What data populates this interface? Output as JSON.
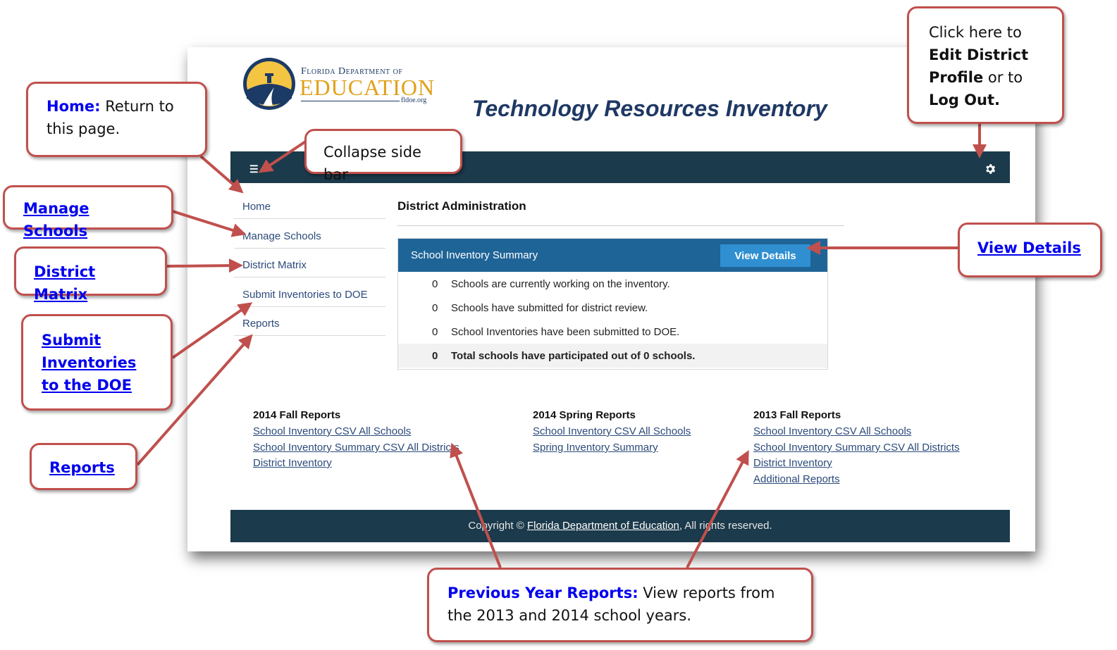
{
  "logo": {
    "line1": "Florida Department of",
    "line2": "EDUCATION",
    "url": "fldoe.org"
  },
  "app": {
    "title": "Technology Resources Inventory"
  },
  "topbar": {
    "menu_icon": "hamburger-icon",
    "settings_icon": "gear-icon"
  },
  "sidebar": {
    "items": [
      {
        "label": "Home"
      },
      {
        "label": "Manage Schools"
      },
      {
        "label": "District Matrix"
      },
      {
        "label": "Submit Inventories to DOE"
      },
      {
        "label": "Reports"
      }
    ]
  },
  "main": {
    "heading": "District Administration",
    "summary": {
      "title": "School Inventory Summary",
      "button": "View Details",
      "rows": [
        {
          "count": "0",
          "text": "Schools are currently working on the inventory."
        },
        {
          "count": "0",
          "text": "Schools have submitted for district review."
        },
        {
          "count": "0",
          "text": "School Inventories have been submitted to DOE."
        },
        {
          "count": "0",
          "text": "Total schools have participated out of 0 schools."
        }
      ]
    }
  },
  "reports": [
    {
      "heading": "2014 Fall Reports",
      "links": [
        "School Inventory CSV All Schools",
        "School Inventory Summary CSV All Districts",
        "District Inventory"
      ]
    },
    {
      "heading": "2014 Spring Reports",
      "links": [
        "School Inventory CSV All Schools",
        "Spring Inventory Summary"
      ]
    },
    {
      "heading": "2013 Fall Reports",
      "links": [
        "School Inventory CSV All Schools",
        "School Inventory Summary CSV All Districts",
        "District Inventory",
        "Additional Reports"
      ]
    }
  ],
  "footer": {
    "prefix": "Copyright © ",
    "link": "Florida Department of Education",
    "suffix": ", All rights reserved."
  },
  "callouts": {
    "home_key": "Home:",
    "home_text": "Return to this page.",
    "collapse": "Collapse side bar",
    "manage_schools": "Manage Schools",
    "district_matrix": "District Matrix",
    "submit": "Submit Inventories to the DOE",
    "reports": "Reports",
    "settings_pre": "Click here to",
    "settings_b1": "Edit District Profile",
    "settings_mid": "or to",
    "settings_b2": "Log Out.",
    "view_details": "View Details",
    "previous_key": "Previous Year Reports:",
    "previous_text": "View reports from the 2013 and 2014 school years."
  },
  "colors": {
    "navbar": "#1b3a4b",
    "summary_header": "#1f6497",
    "button": "#2f8fd0",
    "callout_border": "#c0504d",
    "callout_link": "#0000ee"
  }
}
